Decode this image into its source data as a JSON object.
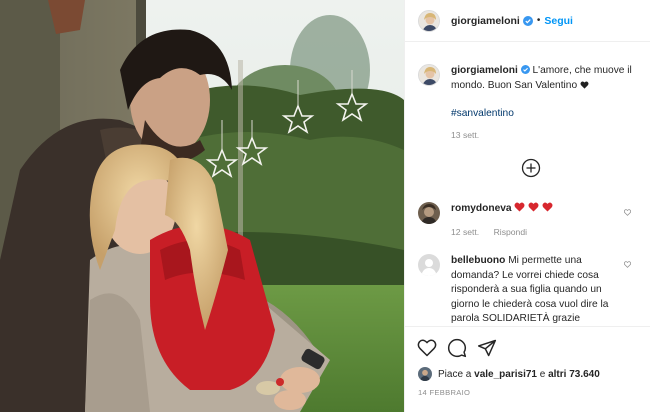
{
  "post": {
    "username": "giorgiameloni",
    "follow_label": "Segui",
    "separator": "•",
    "caption_text": "L'amore, che muove il mondo. Buon San Valentino",
    "hashtag": "#sanvalentino",
    "caption_time": "13 sett."
  },
  "comments": [
    {
      "username": "romydoneva",
      "text": "",
      "hearts": 3,
      "time": "12 sett.",
      "reply_label": "Rispondi"
    },
    {
      "username": "bellebuono",
      "text": "Mi permette una domanda? Le vorrei chiede cosa risponderà a sua figlia quando un giorno le chiederà cosa vuol dire la parola SOLIDARIETÀ grazie"
    }
  ],
  "likes": {
    "prefix": "Piace a",
    "first_user": "vale_parisi71",
    "connector": "e",
    "others": "altri 73.640"
  },
  "date": "14 FEBBRAIO",
  "colors": {
    "accent": "#0095f6",
    "heart": "#ed4956",
    "hashtag": "#00376b",
    "muted": "#8e8e8e"
  },
  "icons": [
    "verified-badge-icon",
    "more-options-icon",
    "add-comment-icon",
    "like-heart-icon",
    "comment-icon",
    "share-icon"
  ]
}
